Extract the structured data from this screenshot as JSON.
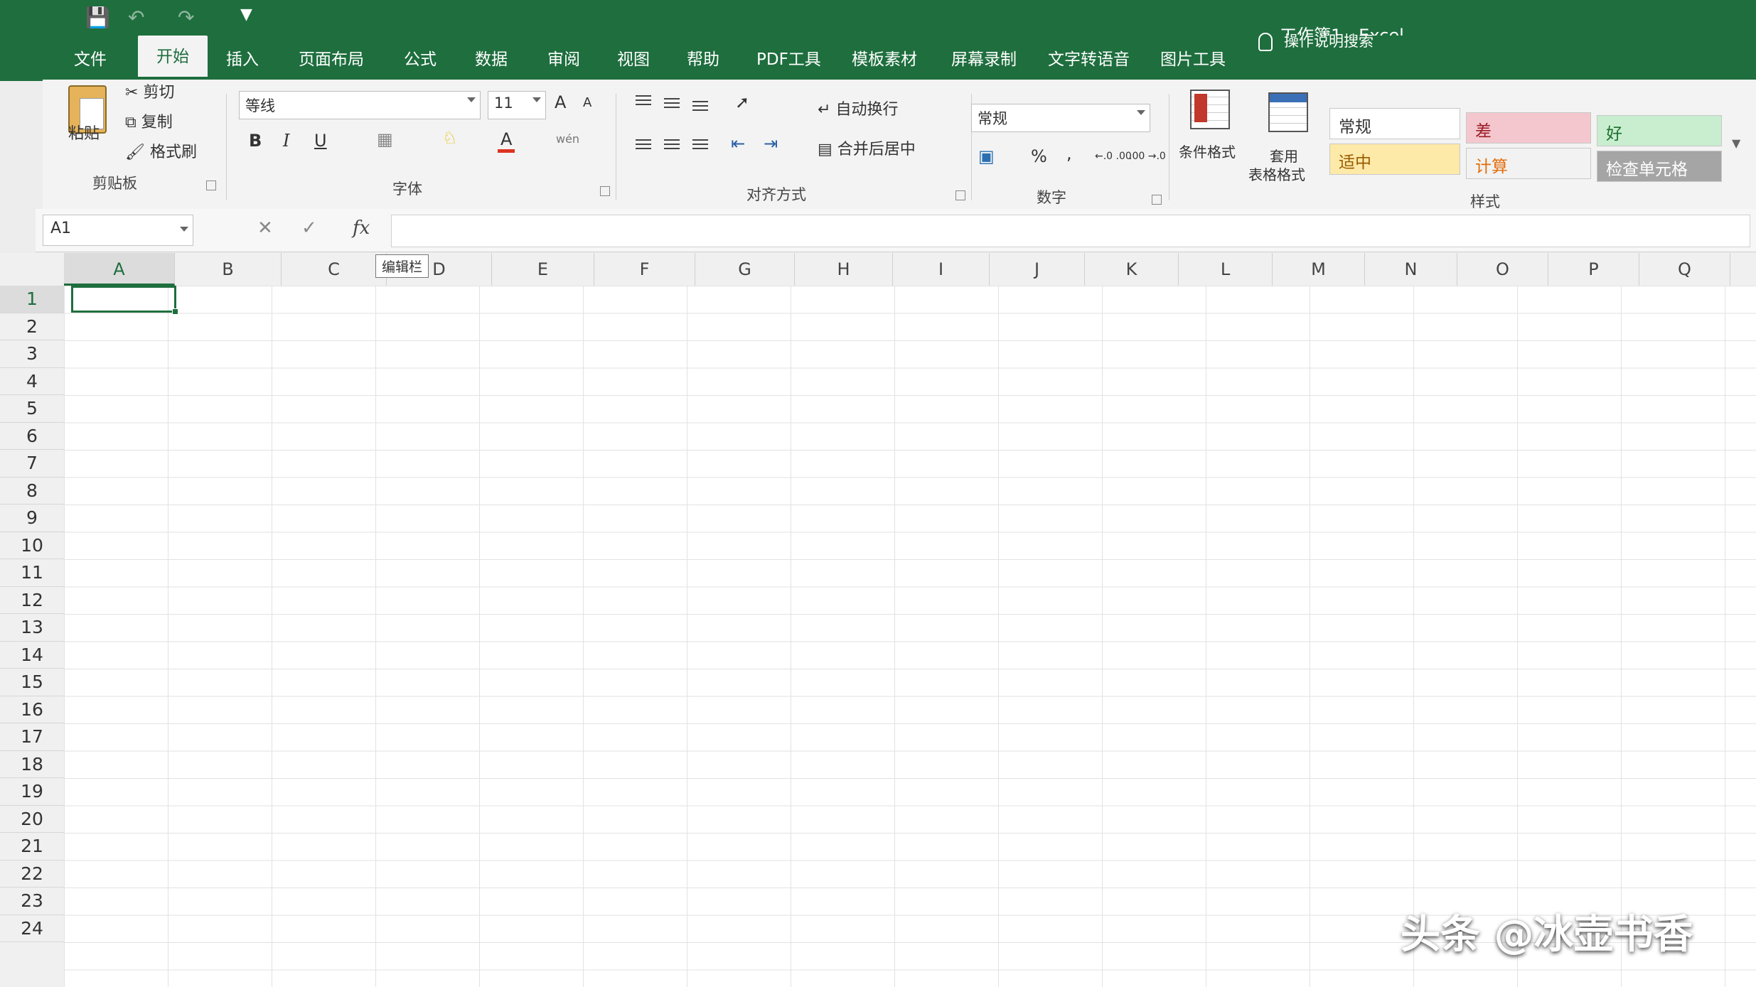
{
  "window": {
    "title": "工作簿1 - Excel"
  },
  "qat": {
    "save_icon": "save-icon",
    "undo_icon": "undo-icon",
    "redo_icon": "redo-icon",
    "customize_icon": "customize-qat-icon"
  },
  "tabs": [
    {
      "label": "文件"
    },
    {
      "label": "开始"
    },
    {
      "label": "插入"
    },
    {
      "label": "页面布局"
    },
    {
      "label": "公式"
    },
    {
      "label": "数据"
    },
    {
      "label": "审阅"
    },
    {
      "label": "视图"
    },
    {
      "label": "帮助"
    },
    {
      "label": "PDF工具"
    },
    {
      "label": "模板素材"
    },
    {
      "label": "屏幕录制"
    },
    {
      "label": "文字转语音"
    },
    {
      "label": "图片工具"
    }
  ],
  "tell_me": "操作说明搜索",
  "clipboard": {
    "paste": "粘贴",
    "cut": "剪切",
    "copy": "复制",
    "format_painter": "格式刷",
    "group": "剪贴板"
  },
  "font": {
    "name": "等线",
    "size": "11",
    "bold": "B",
    "italic": "I",
    "underline": "U",
    "font_color": "A",
    "grow": "A",
    "shrink": "A",
    "phonetic": "wén",
    "group": "字体"
  },
  "alignment": {
    "wrap_text": "自动换行",
    "merge_center": "合并后居中",
    "group": "对齐方式"
  },
  "number": {
    "format": "常规",
    "percent": "%",
    "comma": ",",
    "inc_dec": "←.0 .00",
    "dec_dec": ".00 →.0",
    "group": "数字"
  },
  "styles": {
    "conditional": "条件格式",
    "table_format_1": "套用",
    "table_format_2": "表格格式",
    "cells": [
      {
        "label": "常规",
        "bg": "#ffffff",
        "fg": "#333333"
      },
      {
        "label": "差",
        "bg": "#f4c7ce",
        "fg": "#9c1c26"
      },
      {
        "label": "好",
        "bg": "#c8eecf",
        "fg": "#1e6e2e"
      },
      {
        "label": "适中",
        "bg": "#fde9a8",
        "fg": "#9a5b00"
      },
      {
        "label": "计算",
        "bg": "#f2f2f2",
        "fg": "#e36c0a"
      },
      {
        "label": "检查单元格",
        "bg": "#a5a5a5",
        "fg": "#ffffff"
      }
    ],
    "group": "样式"
  },
  "formula_bar": {
    "name_box": "A1",
    "fx": "fx",
    "tooltip": "编辑栏"
  },
  "columns": [
    "A",
    "B",
    "C",
    "D",
    "E",
    "F",
    "G",
    "H",
    "I",
    "J",
    "K",
    "L",
    "M",
    "N",
    "O",
    "P",
    "Q"
  ],
  "rows": [
    "1",
    "2",
    "3",
    "4",
    "5",
    "6",
    "7",
    "8",
    "9",
    "10",
    "11",
    "12",
    "13",
    "14",
    "15",
    "16",
    "17",
    "18",
    "19",
    "20",
    "21",
    "22",
    "23",
    "24"
  ],
  "watermark": "头条 @冰壶书香",
  "colors": {
    "accent": "#1e6e3e"
  }
}
